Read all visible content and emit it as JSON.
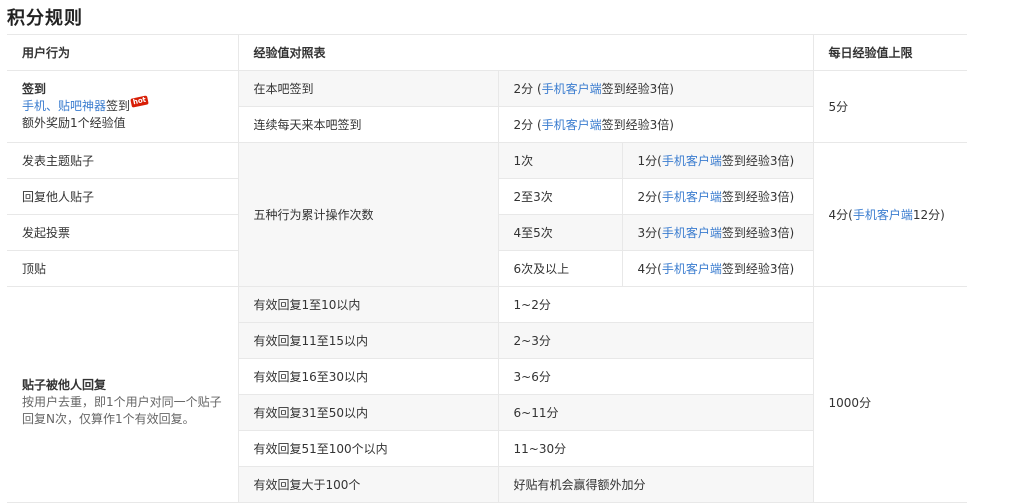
{
  "page_title": "积分规则",
  "headers": {
    "action": "用户行为",
    "exp_table": "经验值对照表",
    "daily_limit": "每日经验值上限"
  },
  "signin": {
    "title": "签到",
    "tools_link": "手机、贴吧神器",
    "tools_suffix": "签到",
    "hot_badge": "hot",
    "bonus": "额外奖励1个经验值",
    "rows": [
      {
        "label": "在本吧签到",
        "value_prefix": "2分 (",
        "link": "手机客户端",
        "value_suffix": "签到经验3倍)"
      },
      {
        "label": "连续每天来本吧签到",
        "value_prefix": "2分 (",
        "link": "手机客户端",
        "value_suffix": "签到经验3倍)"
      }
    ],
    "limit": "5分"
  },
  "posting": {
    "actions": [
      "发表主题贴子",
      "回复他人贴子",
      "发起投票",
      "顶贴"
    ],
    "group_label": "五种行为累计操作次数",
    "rows": [
      {
        "count": "1次",
        "value_prefix": "1分(",
        "link": "手机客户端",
        "value_suffix": "签到经验3倍)"
      },
      {
        "count": "2至3次",
        "value_prefix": "2分(",
        "link": "手机客户端",
        "value_suffix": "签到经验3倍)"
      },
      {
        "count": "4至5次",
        "value_prefix": "3分(",
        "link": "手机客户端",
        "value_suffix": "签到经验3倍)"
      },
      {
        "count": "6次及以上",
        "value_prefix": "4分(",
        "link": "手机客户端",
        "value_suffix": "签到经验3倍)"
      }
    ],
    "limit_prefix": "4分(",
    "limit_link": "手机客户端",
    "limit_suffix": "12分)"
  },
  "replied": {
    "title": "贴子被他人回复",
    "note_line1": "按用户去重，即1个用户对同一个贴子",
    "note_line2": "回复N次，仅算作1个有效回复。",
    "rows": [
      {
        "label": "有效回复1至10以内",
        "value": "1~2分"
      },
      {
        "label": "有效回复11至15以内",
        "value": "2~3分"
      },
      {
        "label": "有效回复16至30以内",
        "value": "3~6分"
      },
      {
        "label": "有效回复31至50以内",
        "value": "6~11分"
      },
      {
        "label": "有效回复51至100个以内",
        "value": "11~30分"
      },
      {
        "label": "有效回复大于100个",
        "value": "好贴有机会赢得额外加分"
      }
    ],
    "limit": "1000分"
  }
}
